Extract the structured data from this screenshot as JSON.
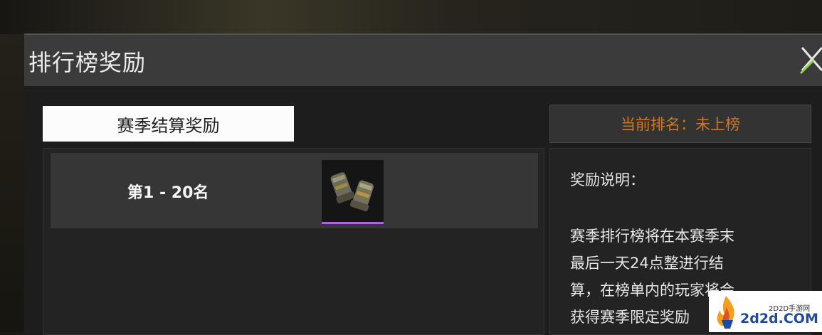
{
  "dialog": {
    "title": "排行榜奖励"
  },
  "tabs": [
    {
      "label": "赛季结算奖励",
      "active": true
    }
  ],
  "current_rank": {
    "text": "当前排名：未上榜",
    "color": "#d2761f"
  },
  "rewards": [
    {
      "rank_label": "第1 - 20名",
      "item_icon": "gauntlets-icon",
      "rarity_color": "#b25fd8"
    }
  ],
  "description": {
    "title": "奖励说明：",
    "body": "赛季排行榜将在本赛季末\n最后一天24点整进行结\n算，在榜单内的玩家将会\n获得赛季限定奖励"
  },
  "watermark": {
    "site_small": "2D2D手游网",
    "site_big": "2d2d.COM"
  }
}
